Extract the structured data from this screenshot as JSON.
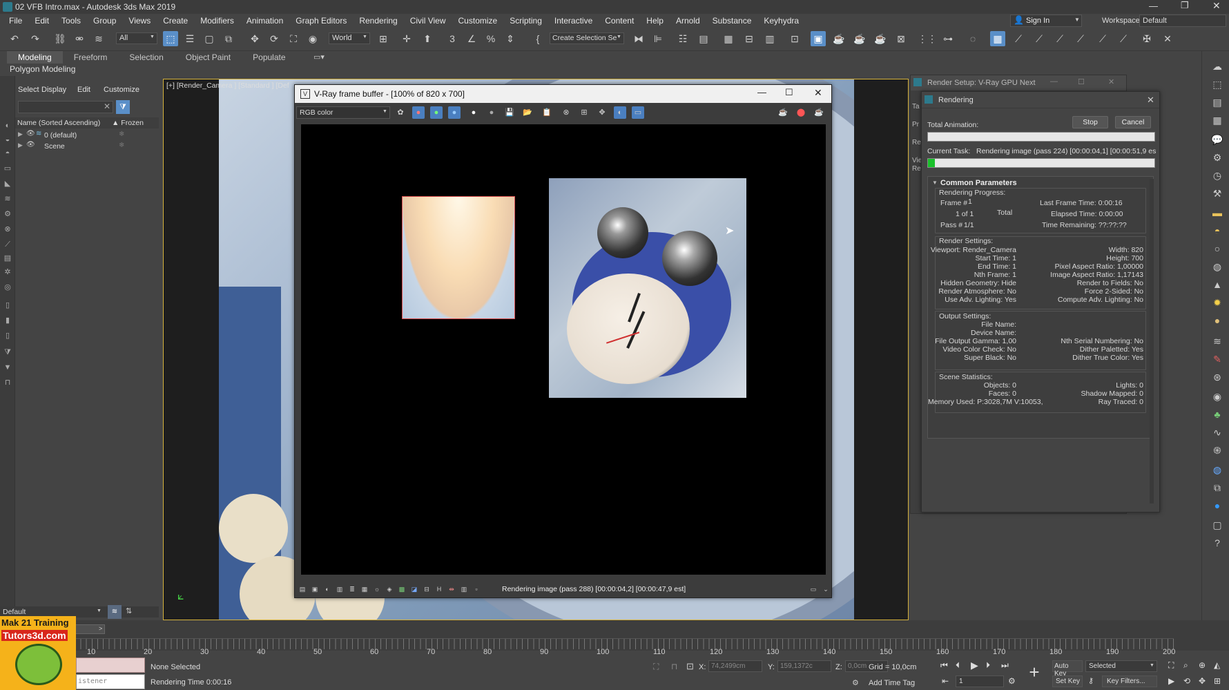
{
  "titlebar": {
    "title": "02 VFB Intro.max - Autodesk 3ds Max 2019"
  },
  "menu": [
    "File",
    "Edit",
    "Tools",
    "Group",
    "Views",
    "Create",
    "Modifiers",
    "Animation",
    "Graph Editors",
    "Rendering",
    "Civil View",
    "Customize",
    "Scripting",
    "Interactive",
    "Content",
    "Help",
    "Arnold",
    "Substance",
    "Keyhydra"
  ],
  "account": {
    "sign_in": "Sign In",
    "workspaces_label": "Workspaces:",
    "workspace": "Default"
  },
  "toolbar": {
    "filter": "All",
    "coord": "World",
    "selection_set": "Create Selection Se"
  },
  "ribbon": {
    "tabs": [
      "Modeling",
      "Freeform",
      "Selection",
      "Object Paint",
      "Populate"
    ],
    "sub": "Polygon Modeling"
  },
  "scene_explorer": {
    "tabs": [
      "Select",
      "Display",
      "Edit",
      "Customize"
    ],
    "col_name": "Name (Sorted Ascending)",
    "col_frozen": "▲ Frozen",
    "items": [
      "0 (default)",
      "Scene"
    ],
    "layer": "Default"
  },
  "viewport": {
    "label": "[+] [Render_Camera ] [Standard ] [Def"
  },
  "vfb": {
    "title": "V-Ray frame buffer - [100% of 820 x 700]",
    "channel": "RGB color",
    "status": "Rendering image (pass 288) [00:00:04,2] [00:00:47,9 est]"
  },
  "render_setup": {
    "title": "Render Setup: V-Ray GPU Next",
    "side_labels": [
      "Ta",
      "Pr",
      "Re",
      "Vie",
      "Re"
    ]
  },
  "rendering": {
    "title": "Rendering",
    "total_animation": "Total Animation:",
    "stop": "Stop",
    "cancel": "Cancel",
    "current_task_label": "Current Task:",
    "current_task": "Rendering image (pass 224) [00:00:04,1] [00:00:51,9 es",
    "task_progress": 0.03,
    "section": "Common Parameters",
    "progress_label": "Rendering Progress:",
    "frame_no": "Frame #",
    "frame_val": "1",
    "of": "1 of 1",
    "total": "Total",
    "pass": "Pass #",
    "pass_val": "1/1",
    "last_frame": "Last Frame Time: 0:00:16",
    "elapsed": "Elapsed Time: 0:00:00",
    "remaining": "Time Remaining: ??:??:??",
    "render_settings": "Render Settings:",
    "rs_left": [
      "Viewport: Render_Camera",
      "Start Time: 1",
      "End Time: 1",
      "Nth Frame: 1",
      "Hidden Geometry: Hide",
      "Render Atmosphere: No",
      "Use Adv. Lighting: Yes"
    ],
    "rs_right": [
      "Width: 820",
      "Height: 700",
      "Pixel Aspect Ratio: 1,00000",
      "Image Aspect Ratio: 1,17143",
      "Render to Fields: No",
      "Force 2-Sided: No",
      "Compute Adv. Lighting: No"
    ],
    "output_settings": "Output Settings:",
    "out_left": [
      "File Name:",
      "Device Name:",
      "File Output Gamma: 1,00",
      "Video Color Check: No",
      "Super Black: No"
    ],
    "out_right": [
      "Nth Serial Numbering: No",
      "Dither Paletted: Yes",
      "Dither True Color: Yes"
    ],
    "scene_stats": "Scene Statistics:",
    "ss_left": [
      "Objects: 0",
      "Faces: 0",
      "Memory Used: P:3028,7M V:10053,"
    ],
    "ss_right": [
      "Lights: 0",
      "Shadow Mapped: 0",
      "Ray Traced: 0"
    ]
  },
  "timeline": {
    "ticks": [
      "10",
      "20",
      "30",
      "40",
      "50",
      "60",
      "70",
      "80",
      "90",
      "100",
      "110",
      "120",
      "130",
      "140",
      "150",
      "160",
      "170",
      "180",
      "190",
      "200"
    ]
  },
  "status": {
    "selection": "None Selected",
    "render_time": "Rendering Time 0:00:16",
    "listener": "istener",
    "x_label": "X:",
    "x_val": "74,2499cm",
    "y_label": "Y:",
    "y_val": "159,1372c",
    "z_label": "Z:",
    "z_val": "0,0cm",
    "grid": "Grid = 10,0cm",
    "add_time_tag": "Add Time Tag",
    "auto_key": "Auto Key",
    "set_key": "Set Key",
    "selected": "Selected",
    "key_filters": "Key Filters...",
    "frame": "1"
  },
  "watermark": {
    "line1": "Mak 21 Training",
    "line2": "Tutors3d.com"
  },
  "colors": {
    "accent": "#5a8fc8",
    "progress": "#19c02a",
    "clock_blue": "#3a4fa8"
  }
}
